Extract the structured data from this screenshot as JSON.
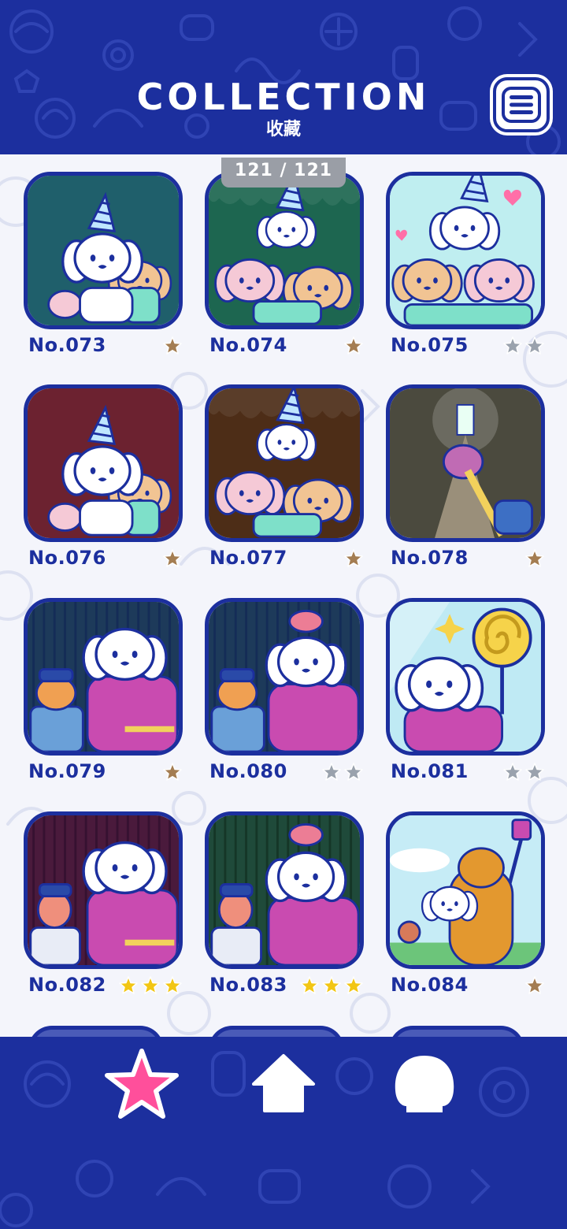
{
  "header": {
    "title": "COLLECTION",
    "subtitle": "收藏",
    "menu_icon": "hamburger-menu-icon"
  },
  "counter": "121 / 121",
  "colors": {
    "brand_blue": "#1c2f9e",
    "star_bronze": "#a47d52",
    "star_silver": "#9aa2ad",
    "star_gold": "#f2c614",
    "active_pink": "#ff4f9b"
  },
  "cards": [
    {
      "label": "No.073",
      "stars": 1,
      "tier": "bronze",
      "scene": "party-hat-crying-dogs"
    },
    {
      "label": "No.074",
      "stars": 1,
      "tier": "bronze",
      "scene": "party-hat-dog-pile"
    },
    {
      "label": "No.075",
      "stars": 2,
      "tier": "silver",
      "scene": "party-hat-hearts"
    },
    {
      "label": "No.076",
      "stars": 1,
      "tier": "bronze",
      "scene": "party-hat-crying-dogs"
    },
    {
      "label": "No.077",
      "stars": 1,
      "tier": "bronze",
      "scene": "party-hat-dog-pile"
    },
    {
      "label": "No.078",
      "stars": 1,
      "tier": "bronze",
      "scene": "escape-tunnel"
    },
    {
      "label": "No.079",
      "stars": 1,
      "tier": "bronze",
      "scene": "police-shiba"
    },
    {
      "label": "No.080",
      "stars": 2,
      "tier": "silver",
      "scene": "police-shiba-bird"
    },
    {
      "label": "No.081",
      "stars": 2,
      "tier": "silver",
      "scene": "lollipop"
    },
    {
      "label": "No.082",
      "stars": 3,
      "tier": "gold",
      "scene": "police-deer"
    },
    {
      "label": "No.083",
      "stars": 3,
      "tier": "gold",
      "scene": "police-deer-bird"
    },
    {
      "label": "No.084",
      "stars": 1,
      "tier": "bronze",
      "scene": "bear-selfie"
    }
  ],
  "nav": [
    {
      "name": "collection",
      "icon": "star-icon",
      "active": true
    },
    {
      "name": "home",
      "icon": "home-icon",
      "active": false
    },
    {
      "name": "character",
      "icon": "dog-head-icon",
      "active": false
    }
  ]
}
